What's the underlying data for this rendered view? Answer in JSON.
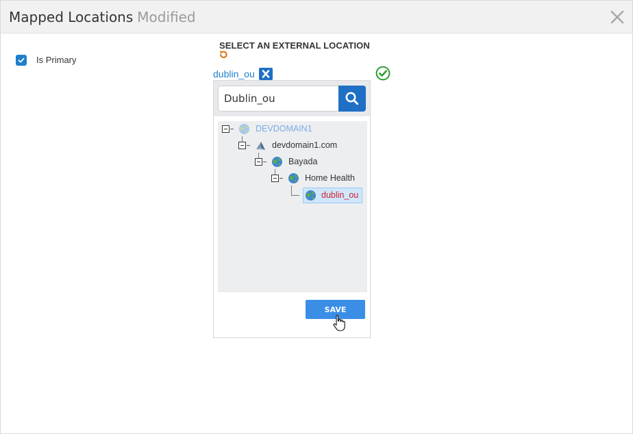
{
  "header": {
    "title": "Mapped Locations",
    "status": "Modified"
  },
  "primary": {
    "label": "Is Primary",
    "checked": true
  },
  "external_location": {
    "section_title": "SELECT AN EXTERNAL LOCATION",
    "selected_tag": "dublin_ou",
    "search": {
      "value": "Dublin_ou"
    },
    "tree": [
      {
        "label": "DEVDOMAIN1",
        "state": "root"
      },
      {
        "label": "devdomain1.com",
        "state": "normal"
      },
      {
        "label": "Bayada",
        "state": "normal"
      },
      {
        "label": "Home Health",
        "state": "normal"
      },
      {
        "label": "dublin_ou",
        "state": "selected"
      }
    ],
    "save_label": "SAVE"
  },
  "colors": {
    "accent": "#1f6fc4",
    "save": "#3b8ee6",
    "selected_text": "#d01f2c",
    "ok": "#2e9e2e",
    "refresh": "#e07b1a"
  }
}
